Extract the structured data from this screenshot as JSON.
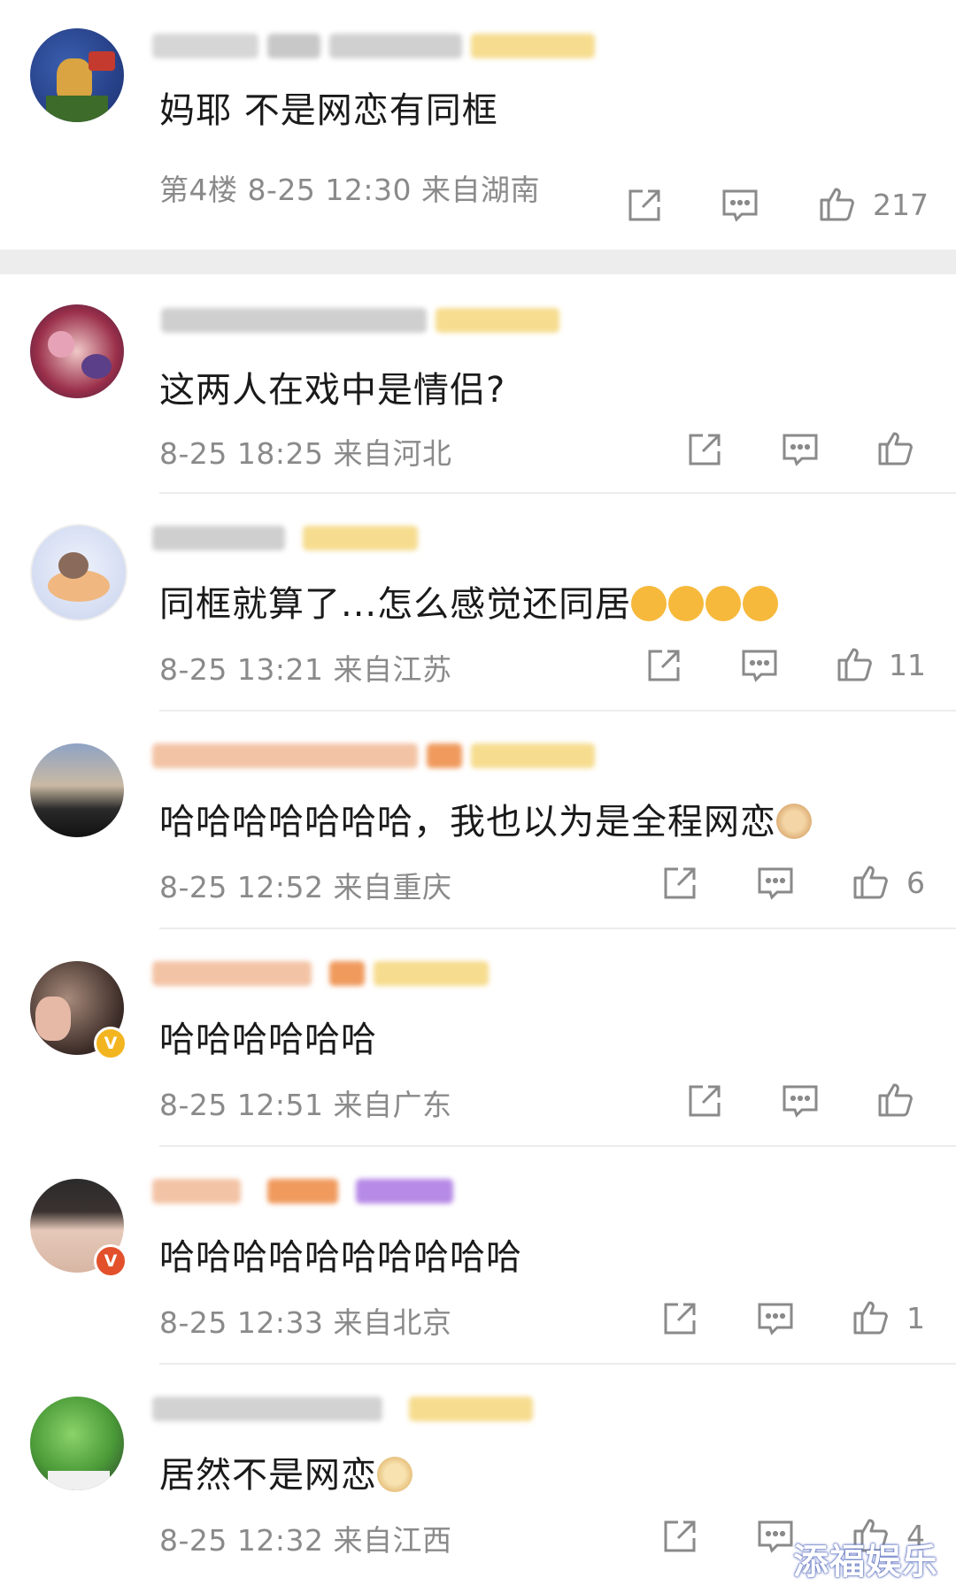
{
  "comments": [
    {
      "text": "妈耶 不是网恋有同框",
      "meta": "第4楼 8-25 12:30 来自湖南",
      "likes": "217",
      "badge": null
    },
    {
      "text": "这两人在戏中是情侣?",
      "meta": "8-25 18:25 来自河北",
      "likes": "",
      "badge": null
    },
    {
      "text": "同框就算了...怎么感觉还同居",
      "meta": "8-25 13:21 来自江苏",
      "likes": "11",
      "badge": null
    },
    {
      "text": "哈哈哈哈哈哈哈，我也以为是全程网恋",
      "meta": "8-25 12:52 来自重庆",
      "likes": "6",
      "badge": null
    },
    {
      "text": "哈哈哈哈哈哈",
      "meta": "8-25 12:51 来自广东",
      "likes": "",
      "badge": "V"
    },
    {
      "text": "哈哈哈哈哈哈哈哈哈哈",
      "meta": "8-25 12:33 来自北京",
      "likes": "1",
      "badge": "V"
    },
    {
      "text": "居然不是网恋",
      "meta": "8-25 12:32 来自江西",
      "likes": "4",
      "badge": null
    }
  ],
  "colors": {
    "meta_gray": "#8a8a8a",
    "gold_badge": "#f3b51f",
    "red_badge": "#e2512b",
    "separator": "#ededed"
  },
  "icons": [
    "share-icon",
    "comment-icon",
    "like-icon"
  ],
  "watermark": "添福娱乐"
}
